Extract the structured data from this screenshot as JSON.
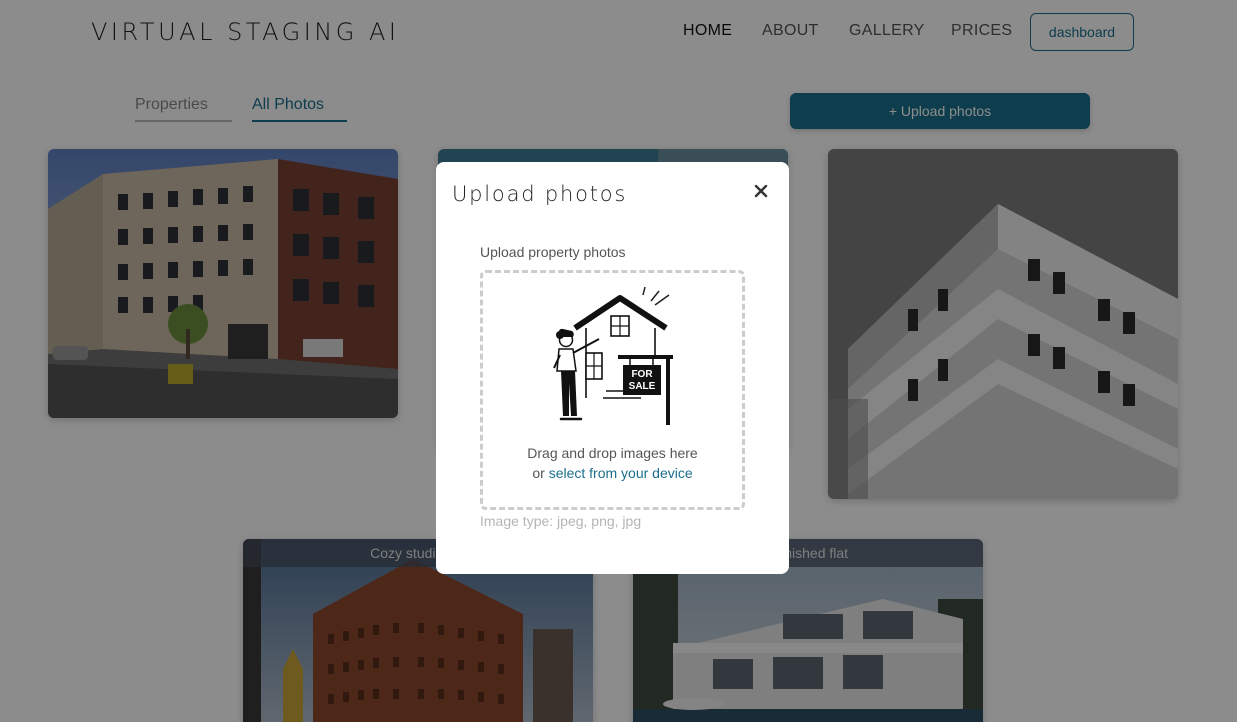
{
  "header": {
    "logo": "VIRTUAL STAGING AI",
    "nav": [
      "HOME",
      "ABOUT",
      "GALLERY",
      "PRICES"
    ],
    "dashboard": "dashboard"
  },
  "tabs": {
    "properties": "Properties",
    "all_photos": "All Photos"
  },
  "upload_button": "+ Upload photos",
  "cards": {
    "card4_caption": "Cozy studio in t",
    "card5_caption": "furnished flat"
  },
  "modal": {
    "title": "Upload photos",
    "close": "×",
    "label": "Upload property photos",
    "sign_line1": "FOR",
    "sign_line2": "SALE",
    "drop_text": "Drag and drop images here",
    "or": "or",
    "select_link": "select from your device",
    "image_type": "Image type: jpeg, png, jpg"
  },
  "colors": {
    "accent": "#1b6f8c"
  }
}
